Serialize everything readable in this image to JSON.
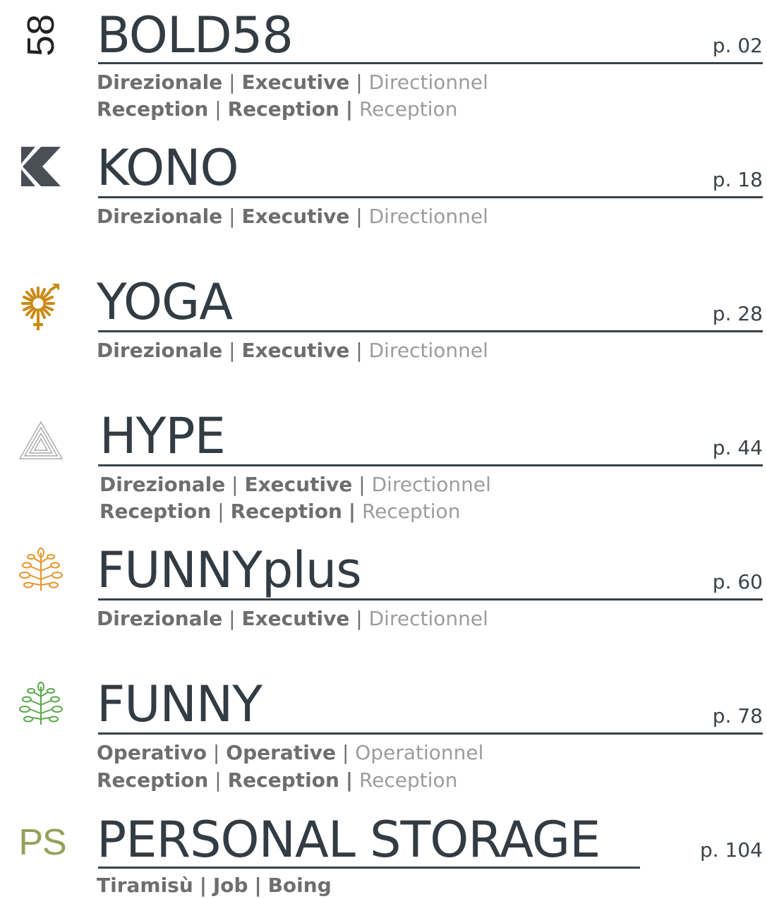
{
  "entries": [
    {
      "logo": "58-logo",
      "logo_text": "58",
      "title": "BOLD58",
      "page": "p. 02",
      "lines": [
        {
          "a": "Direzionale",
          "b": "Executive",
          "c": "Directionnel"
        },
        {
          "a": "Reception",
          "b": "Reception",
          "c": "Reception"
        }
      ]
    },
    {
      "logo": "kono-k-logo",
      "title": "KONO",
      "page": "p. 18",
      "lines": [
        {
          "a": "Direzionale",
          "b": "Executive",
          "c": "Directionnel"
        }
      ]
    },
    {
      "logo": "yoga-sun-logo",
      "title": "YOGA",
      "page": "p. 28",
      "lines": [
        {
          "a": "Direzionale",
          "b": "Executive",
          "c": "Directionnel"
        }
      ]
    },
    {
      "logo": "hype-triangle-logo",
      "title": "HYPE",
      "page": "p. 44",
      "lines": [
        {
          "a": "Direzionale",
          "b": "Executive",
          "c": "Directionnel"
        },
        {
          "a": "Reception",
          "b": "Reception",
          "c": "Reception"
        }
      ]
    },
    {
      "logo": "funnyplus-tree-logo",
      "title": "FUNNYplus",
      "page": "p. 60",
      "lines": [
        {
          "a": "Direzionale",
          "b": "Executive",
          "c": "Directionnel"
        }
      ]
    },
    {
      "logo": "funny-tree-logo",
      "title": "FUNNY",
      "page": "p. 78",
      "lines": [
        {
          "a": "Operativo",
          "b": "Operative",
          "c": "Operationnel"
        },
        {
          "a": "Reception",
          "b": "Reception",
          "c": "Reception"
        }
      ]
    },
    {
      "logo": "ps-logo",
      "logo_text": "PS",
      "title": "PERSONAL STORAGE",
      "page": "p. 104",
      "lines": [
        {
          "a": "Tiramisù",
          "b": "Job",
          "c": "Boing"
        }
      ]
    }
  ],
  "colors": {
    "title": "#333b43",
    "subtitle_bold": "#6e6e70",
    "subtitle_light": "#9c9c9e",
    "yoga": "#c98a14",
    "funnyplus": "#e6952a",
    "funny": "#5aa84a",
    "ps": "#97a05a",
    "kono": "#4a4f56"
  },
  "separator": "|"
}
